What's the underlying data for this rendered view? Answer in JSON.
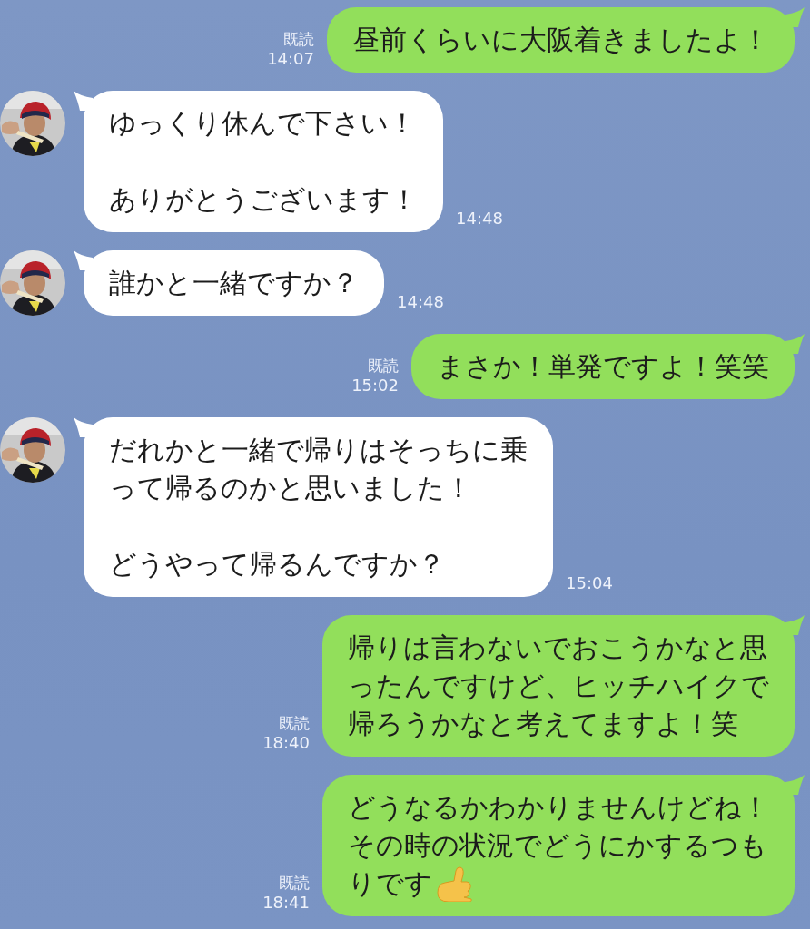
{
  "messages": [
    {
      "kind": "sent",
      "read": "既読",
      "time": "14:07",
      "paragraphs": [
        [
          "昼前くらいに大阪着きましたよ！"
        ]
      ]
    },
    {
      "kind": "received",
      "avatar": {
        "kind": "picture"
      },
      "time": "14:48",
      "paragraphs": [
        [
          "ゆっくり休んで下さい！"
        ],
        [
          "ありがとうございます！"
        ]
      ]
    },
    {
      "kind": "received",
      "avatar": {
        "kind": "picture"
      },
      "time": "14:48",
      "paragraphs": [
        [
          "誰かと一緒ですか？"
        ]
      ]
    },
    {
      "kind": "sent",
      "read": "既読",
      "time": "15:02",
      "paragraphs": [
        [
          "まさか！単発ですよ！笑笑"
        ]
      ]
    },
    {
      "kind": "received",
      "avatar": {
        "kind": "picture"
      },
      "time": "15:04",
      "paragraphs": [
        [
          "だれかと一緒で帰りはそっちに乗",
          "って帰るのかと思いました！"
        ],
        [
          "どうやって帰るんですか？"
        ]
      ]
    },
    {
      "kind": "sent",
      "read": "既読",
      "time": "18:40",
      "paragraphs": [
        [
          "帰りは言わないでおこうかなと思",
          "ったんですけど、ヒッチハイクで",
          "帰ろうかなと考えてますよ！笑"
        ]
      ]
    },
    {
      "kind": "sent",
      "read": "既読",
      "time": "18:41",
      "trailing_hand_icon": true,
      "paragraphs": [
        [
          "どうなるかわかりませんけどね！",
          "その時の状況でどうにかするつも",
          "りです"
        ]
      ]
    }
  ]
}
